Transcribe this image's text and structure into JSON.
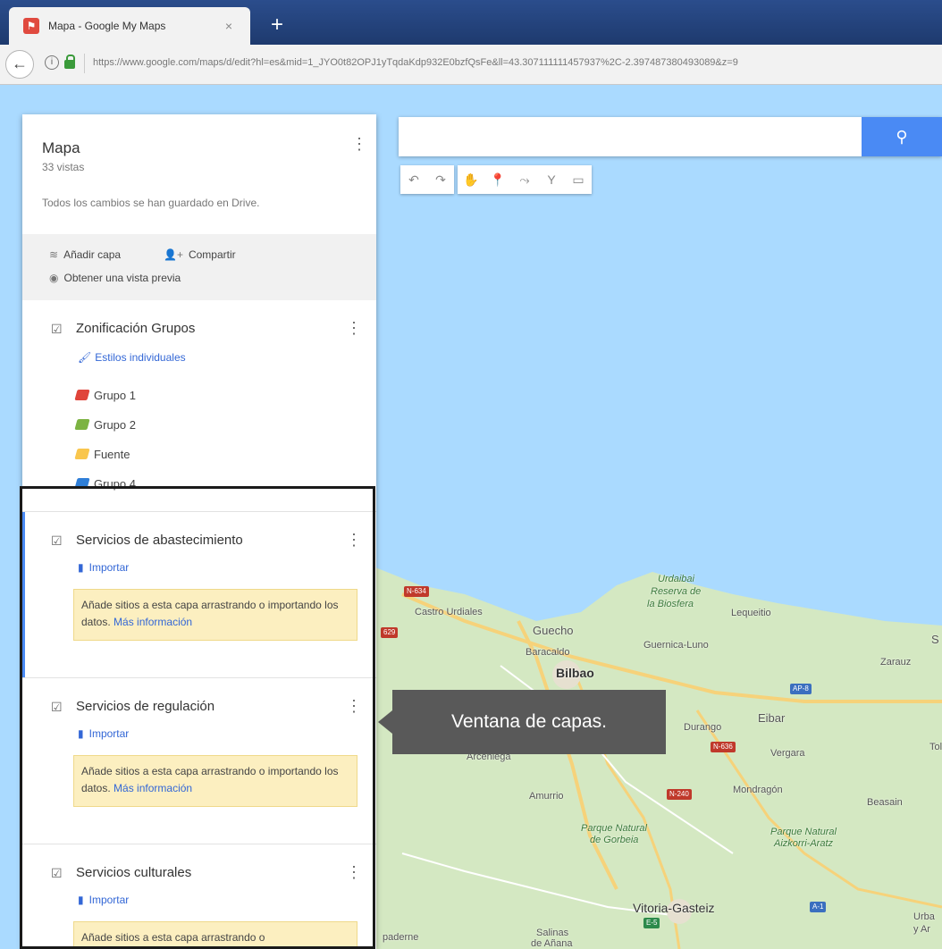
{
  "browser": {
    "tab_title": "Mapa - Google My Maps",
    "tab_close": "×",
    "new_tab": "+",
    "url": "https://www.google.com/maps/d/edit?hl=es&mid=1_JYO0t82OPJ1yTqdaKdp932E0bzfQsFe&ll=43.307111111457937%2C-2.397487380493089&z=9"
  },
  "panel": {
    "title": "Mapa",
    "views": "33 vistas",
    "saved_status": "Todos los cambios se han guardado en Drive.",
    "add_layer": "Añadir capa",
    "share": "Compartir",
    "preview": "Obtener una vista previa"
  },
  "layers": [
    {
      "name": "Zonificación Grupos",
      "style_link": "Estilos individuales",
      "groups": [
        {
          "label": "Grupo 1",
          "color": "#e0443a"
        },
        {
          "label": "Grupo 2",
          "color": "#7cb342"
        },
        {
          "label": "Fuente",
          "color": "#f9c64d"
        },
        {
          "label": "Grupo 4",
          "color": "#2f7fd8"
        }
      ]
    },
    {
      "name": "Servicios de abastecimiento",
      "import": "Importar",
      "notice": "Añade sitios a esta capa arrastrando o importando los datos.",
      "more": "Más información"
    },
    {
      "name": "Servicios de regulación",
      "import": "Importar",
      "notice": "Añade sitios a esta capa arrastrando o importando los datos.",
      "more": "Más información"
    },
    {
      "name": "Servicios culturales",
      "import": "Importar",
      "notice": "Añade sitios a esta capa arrastrando o"
    }
  ],
  "callout": "Ventana de capas.",
  "map_labels": {
    "urdaibai": "Urdaibai",
    "reserva": "Reserva de",
    "biosfera": "la Biosfera",
    "lequeitio": "Lequeitio",
    "castro": "Castro Urdiales",
    "guecho": "Guecho",
    "baracaldo": "Baracaldo",
    "bilbao": "Bilbao",
    "guernica": "Guernica-Luno",
    "zarauz": "Zarauz",
    "durango": "Durango",
    "eibar": "Eibar",
    "vergara": "Vergara",
    "arceniega": "Arceniega",
    "mondragon": "Mondragón",
    "amurrio": "Amurrio",
    "beasain": "Beasain",
    "gorbeia1": "Parque Natural",
    "gorbeia2": "de Gorbeia",
    "aizkorri1": "Parque Natural",
    "aizkorri2": "Aizkorri-Aratz",
    "vitoria": "Vitoria-Gasteiz",
    "salinas": "Salinas",
    "salinas2": "de Añana",
    "lapuebla": "paderne",
    "tolosa": "Tol",
    "urba": "Urba",
    "yar": "y Ar",
    "s": "S"
  },
  "shields": {
    "n634": "N-634",
    "a8": "AP-8",
    "n636": "N-636",
    "n240": "N-240",
    "a1": "A-1",
    "e5": "E-5",
    "n629": "629"
  },
  "colors": {
    "sea": "#aadaff",
    "land": "#d4e8c2",
    "accent": "#4a8af4"
  }
}
